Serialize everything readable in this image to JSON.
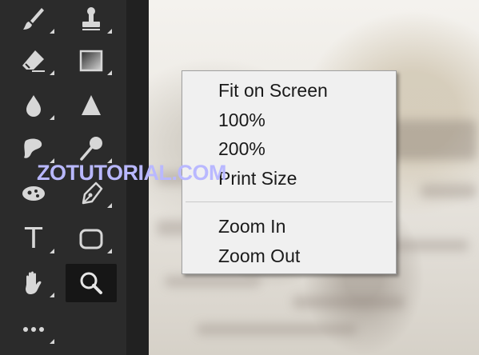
{
  "toolbar": {
    "tools": [
      {
        "name": "brush-tool",
        "icon": "brush-icon"
      },
      {
        "name": "clone-stamp-tool",
        "icon": "stamp-icon"
      },
      {
        "name": "eraser-tool",
        "icon": "eraser-icon"
      },
      {
        "name": "gradient-tool",
        "icon": "gradient-icon"
      },
      {
        "name": "blur-tool",
        "icon": "drop-icon"
      },
      {
        "name": "sharpen-tool",
        "icon": "triangle-icon"
      },
      {
        "name": "smudge-tool",
        "icon": "smudge-icon"
      },
      {
        "name": "dodge-tool",
        "icon": "dodge-icon"
      },
      {
        "name": "sponge-tool",
        "icon": "sponge-icon"
      },
      {
        "name": "pen-tool",
        "icon": "pen-icon"
      },
      {
        "name": "type-tool",
        "icon": "type-icon"
      },
      {
        "name": "shape-tool",
        "icon": "rounded-rectangle-icon"
      },
      {
        "name": "hand-tool",
        "icon": "hand-icon"
      },
      {
        "name": "zoom-tool",
        "icon": "magnifier-icon",
        "active": true
      },
      {
        "name": "more-tools",
        "icon": "ellipsis-icon"
      }
    ],
    "type_glyph": "T",
    "background": "#2b2b2b",
    "icon_color": "#d7d7d7"
  },
  "context_menu": {
    "items": [
      "Fit on Screen",
      "100%",
      "200%",
      "Print Size"
    ],
    "zoom_items": [
      "Zoom In",
      "Zoom Out"
    ],
    "background": "#f0f0f0"
  },
  "watermark": {
    "text": "ZOTUTORIAL.COM",
    "color": "#b9b8ff"
  }
}
